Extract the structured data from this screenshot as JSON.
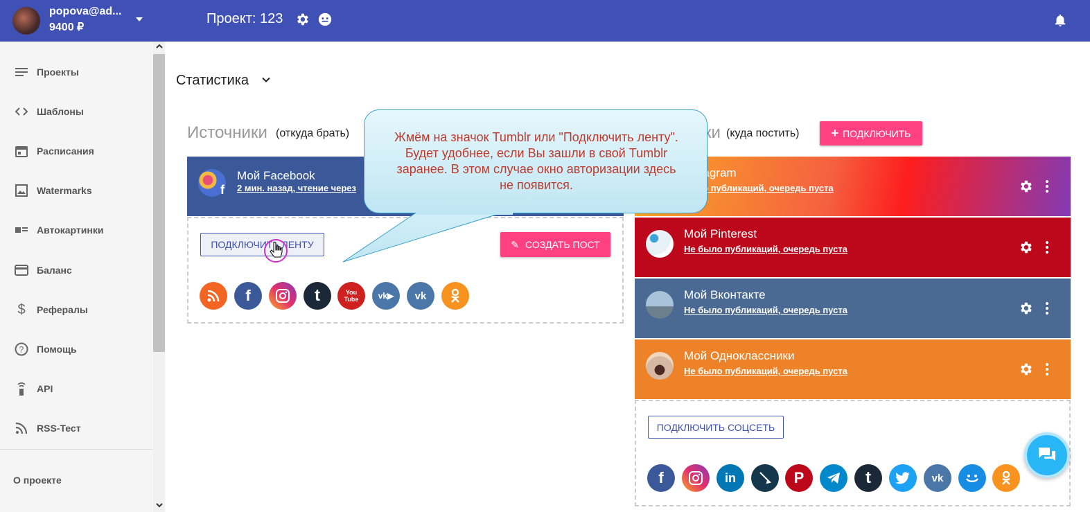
{
  "header": {
    "user_email": "popova@ad...",
    "user_balance": "9400 ₽",
    "project_title": "Проект: 123",
    "icons": [
      "gear-icon",
      "bot-icon",
      "bell-icon",
      "chevron-down-icon"
    ],
    "color": "#3f51b5"
  },
  "sidebar": {
    "items": [
      {
        "label": "Проекты",
        "icon": "list-icon"
      },
      {
        "label": "Шаблоны",
        "icon": "code-icon"
      },
      {
        "label": "Расписания",
        "icon": "calendar-icon"
      },
      {
        "label": "Watermarks",
        "icon": "image-icon"
      },
      {
        "label": "Автокартинки",
        "icon": "autopicture-icon"
      },
      {
        "label": "Баланс",
        "icon": "credit-card-icon"
      },
      {
        "label": "Рефералы",
        "icon": "dollar-icon"
      },
      {
        "label": "Помощь",
        "icon": "help-icon"
      },
      {
        "label": "API",
        "icon": "api-icon"
      },
      {
        "label": "RSS-Тест",
        "icon": "rss-icon"
      }
    ],
    "about": "О проекте"
  },
  "main": {
    "stats_title": "Статистика",
    "sources": {
      "heading": "Источники",
      "subheading": "(откуда брать)",
      "card": {
        "name": "Мой Facebook",
        "sub": "2 мин. назад, чтение через",
        "badge": "f",
        "color": "#3b5998"
      },
      "connect_feed_label": "ПОДКЛЮЧИТЬ ЛЕНТУ",
      "create_post_label": "СОЗДАТЬ ПОСТ",
      "networks": [
        {
          "icon": "rss-icon",
          "color": "#f26522"
        },
        {
          "icon": "facebook-icon",
          "color": "#3b5998"
        },
        {
          "icon": "instagram-icon",
          "color": "#e1306c"
        },
        {
          "icon": "tumblr-icon",
          "color": "#1a2838"
        },
        {
          "icon": "youtube-icon",
          "color": "#cd201f"
        },
        {
          "icon": "vk-video-icon",
          "color": "#4a76a8"
        },
        {
          "icon": "vk-icon",
          "color": "#4a76a8"
        },
        {
          "icon": "odnoklassniki-icon",
          "color": "#f7931e"
        }
      ]
    },
    "targets": {
      "heading_suffix": "ки",
      "subheading": "(куда постить)",
      "connect_label": "ПОДКЛЮЧИТЬ",
      "cards": [
        {
          "name": "Instagram",
          "sub": "было публикаций, очередь пуста",
          "color": "#f56040"
        },
        {
          "name": "Мой Pinterest",
          "sub": "Не было публикаций, очередь пуста",
          "color": "#bd081c"
        },
        {
          "name": "Мой Вконтакте",
          "sub": "Не было публикаций, очередь пуста",
          "color": "#4a6a94"
        },
        {
          "name": "Мой Одноклассники",
          "sub": "Не было публикаций, очередь пуста",
          "color": "#ee8228"
        }
      ],
      "connect_social_label": "ПОДКЛЮЧИТЬ СОЦСЕТЬ",
      "networks": [
        {
          "icon": "facebook-icon",
          "color": "#3b5998"
        },
        {
          "icon": "instagram-icon",
          "color": "#e1306c"
        },
        {
          "icon": "linkedin-icon",
          "color": "#0077b5"
        },
        {
          "icon": "livejournal-icon",
          "color": "#15374c"
        },
        {
          "icon": "pinterest-icon",
          "color": "#bd081c"
        },
        {
          "icon": "telegram-icon",
          "color": "#0088cc"
        },
        {
          "icon": "tumblr-icon",
          "color": "#1a2838"
        },
        {
          "icon": "twitter-icon",
          "color": "#1da1f2"
        },
        {
          "icon": "vk-icon",
          "color": "#4a76a8"
        },
        {
          "icon": "mymail-icon",
          "color": "#168de2"
        },
        {
          "icon": "odnoklassniki-icon",
          "color": "#f7931e"
        }
      ]
    }
  },
  "tooltip": {
    "lines": [
      "Жмём на значок Tumblr или \"Подключить ленту\".",
      "Будет удобнее, если Вы зашли в свой Tumblr",
      "заранее. В этом случае окно авторизации здесь",
      "не появится."
    ],
    "text_color": "#c0392b"
  },
  "accent_color": "#ff4081"
}
